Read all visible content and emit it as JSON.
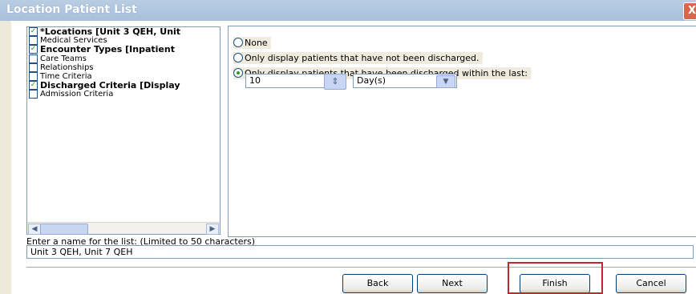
{
  "window": {
    "title": "Location Patient List",
    "close_label": "X"
  },
  "criteria": [
    {
      "label": "*Locations [Unit 3 QEH, Unit",
      "checked": true,
      "bold": true
    },
    {
      "label": "Medical Services",
      "checked": false,
      "bold": false
    },
    {
      "label": "Encounter Types [Inpatient",
      "checked": true,
      "bold": true
    },
    {
      "label": "Care Teams",
      "checked": false,
      "bold": false
    },
    {
      "label": "Relationships",
      "checked": false,
      "bold": false
    },
    {
      "label": "Time Criteria",
      "checked": false,
      "bold": false
    },
    {
      "label": "Discharged Criteria [Display",
      "checked": true,
      "bold": true
    },
    {
      "label": "Admission Criteria",
      "checked": false,
      "bold": false
    }
  ],
  "options": {
    "none": "None",
    "not_discharged": "Only display patients that have not been discharged.",
    "discharged_within": "Only display patients that have been discharged within the last:",
    "selected": "discharged_within"
  },
  "discharge": {
    "value": "10",
    "unit": "Day(s)"
  },
  "list_name": {
    "label": "Enter a name for the list: (Limited to 50 characters)",
    "value": "Unit 3 QEH, Unit 7 QEH"
  },
  "buttons": {
    "back": "Back",
    "next": "Next",
    "finish": "Finish",
    "cancel": "Cancel"
  },
  "colors": {
    "title_bar": "#b9cde3",
    "check_mark": "#21a121",
    "highlight": "#c0282d"
  }
}
